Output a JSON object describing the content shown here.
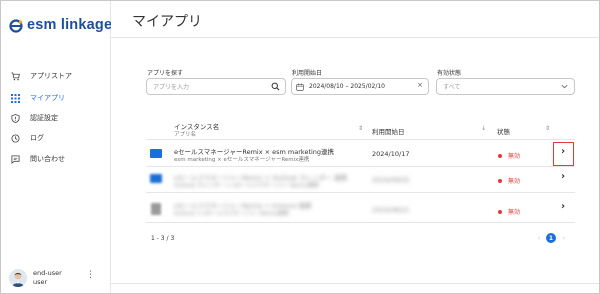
{
  "app": {
    "logo_text": "esm linkage"
  },
  "sidebar": {
    "items": [
      {
        "label": "アプリストア",
        "icon": "cart-icon"
      },
      {
        "label": "マイアプリ",
        "icon": "grid-icon",
        "active": true
      },
      {
        "label": "認証設定",
        "icon": "shield-icon"
      },
      {
        "label": "ログ",
        "icon": "history-icon"
      },
      {
        "label": "問い合わせ",
        "icon": "chat-icon"
      }
    ],
    "user": {
      "name": "end-user",
      "role": "user"
    }
  },
  "page": {
    "title": "マイアプリ"
  },
  "filters": {
    "search": {
      "label": "アプリを探す",
      "placeholder": "アプリを入力"
    },
    "date": {
      "label": "利用開始日",
      "value": "2024/08/10 – 2025/02/10"
    },
    "status": {
      "label": "有効状態",
      "placeholder": "すべて"
    }
  },
  "table": {
    "headers": {
      "instance": "インスタンス名",
      "app": "アプリ名",
      "start_date": "利用開始日",
      "status": "状態"
    },
    "rows": [
      {
        "name": "eセールスマネージャーRemix × esm marketing連携",
        "app": "esm marketing × eセールスマネージャーRemix連携",
        "date": "2024/10/17",
        "status": "無効",
        "blurred": false
      },
      {
        "name": "eセールスマネージャーRemix × Outlook カレンダー 連携",
        "app": "Outlook カレンダー × eセールスマネージャーRemix連携",
        "date": "2024/09/05",
        "status": "無効",
        "blurred": true
      },
      {
        "name": "eセールスマネージャーRemix × kintone 連携",
        "app": "kintone × eセールスマネージャーRemix連携",
        "date": "2024/08/21",
        "status": "無効",
        "blurred": true
      }
    ]
  },
  "pagination": {
    "count": "1 - 3 / 3",
    "current": "1"
  },
  "colors": {
    "accent": "#1d6fd6",
    "brand": "#1d4f9a",
    "status_inactive": "#e03b3b",
    "highlight_box": "#e53935"
  }
}
